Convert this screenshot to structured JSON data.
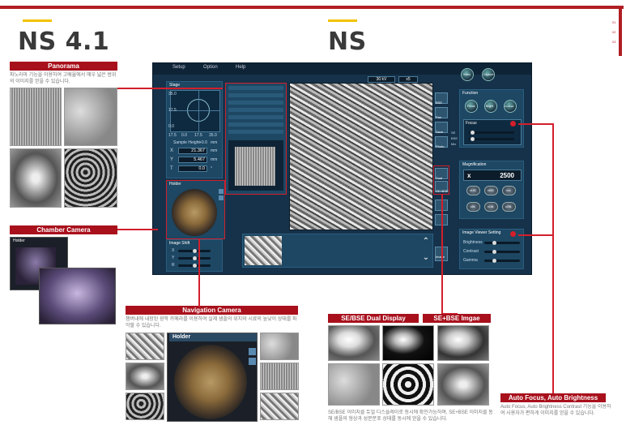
{
  "page": {
    "left_title": "NS 4.1",
    "right_title": "NS",
    "side_marks": [
      "01",
      "02",
      "03"
    ]
  },
  "colors": {
    "frame": "#b01e23",
    "accent": "#f2c200",
    "label_bg": "#a8101c",
    "callout": "#d21f2b"
  },
  "panorama": {
    "label": "Panorama",
    "text": "파노라마 기능을 이용하여 고배율에서 매우 넓은 범위의 이미지를 얻을 수 있습니다."
  },
  "chamber_camera": {
    "label": "Chamber Camera",
    "inner_title": "Holder"
  },
  "navigation_camera": {
    "label": "Navigation Camera",
    "text": "챔버내에 내장된 광학 카메라를 이용하여 실제 샘플의 위치와 시료의 높낮이 상태를 파악할 수 있습니다.",
    "holder_title": "Holder"
  },
  "dual_display": {
    "label": "SE/BSE Dual Display",
    "text": "SE/BSE 이미지를 듀얼 디스플레이로 동시에 확인가능하며, SE+BSE 이미지를 통해 샘플의 형상과 성분분포 상태를 동시에 얻을 수 있습니다."
  },
  "se_bse_image": {
    "label": "SE+BSE Imgae"
  },
  "autofocus": {
    "label": "Auto Focus, Auto Brightness Contrast",
    "text": "Auto Focus, Auto Brightness Contrast 기능을 이용하여 사용자가 편하게 이미지를 얻을 수 있습니다."
  },
  "app": {
    "menu": [
      "Setup",
      "Option",
      "Help"
    ],
    "top_bar": {
      "kv": "30 kV",
      "ratio": "x5"
    },
    "stage": {
      "title": "Stage",
      "axis_values": [
        "17.5",
        "0.0",
        "17.5",
        "35.0"
      ],
      "y_values": [
        "35.0",
        "17.5",
        "0.0"
      ],
      "sample_height_label": "Sample Height",
      "sample_height_value": "+0.0",
      "sample_height_unit": "mm",
      "x_label": "X",
      "x_value": "21.367",
      "x_unit": "mm",
      "y_label": "Y",
      "y_value": "5.467",
      "y_unit": "mm",
      "t_label": "T",
      "t_value": "0.0",
      "t_unit": "°"
    },
    "holder": {
      "title": "Holder"
    },
    "image_shift": {
      "title": "Image Shift",
      "labels": [
        "X",
        "Y",
        "R"
      ]
    },
    "top_buttons": [
      "Video",
      "Capture"
    ],
    "function": {
      "title": "Function",
      "buttons": [
        "Focus",
        "Bright",
        "Contrast"
      ]
    },
    "focus": {
      "title": "Focus"
    },
    "magnification": {
      "title": "Magnification",
      "prefix": "x",
      "value": "2500",
      "presets": [
        "x100",
        "x500",
        "x1k",
        "x5k",
        "x10k",
        "x20k"
      ]
    },
    "image_viewer": {
      "title": "Image Viewer Setting",
      "brightness": "Brightness",
      "contrast": "Contrast",
      "gamma": "Gamma"
    },
    "tools": [
      "BSE",
      "Pan",
      "Save",
      "Dual",
      "Photo",
      "SE+BSE",
      "Image"
    ],
    "detector_options": [
      "SE",
      "BSE",
      "Mix"
    ],
    "bottom_button": "Image"
  }
}
